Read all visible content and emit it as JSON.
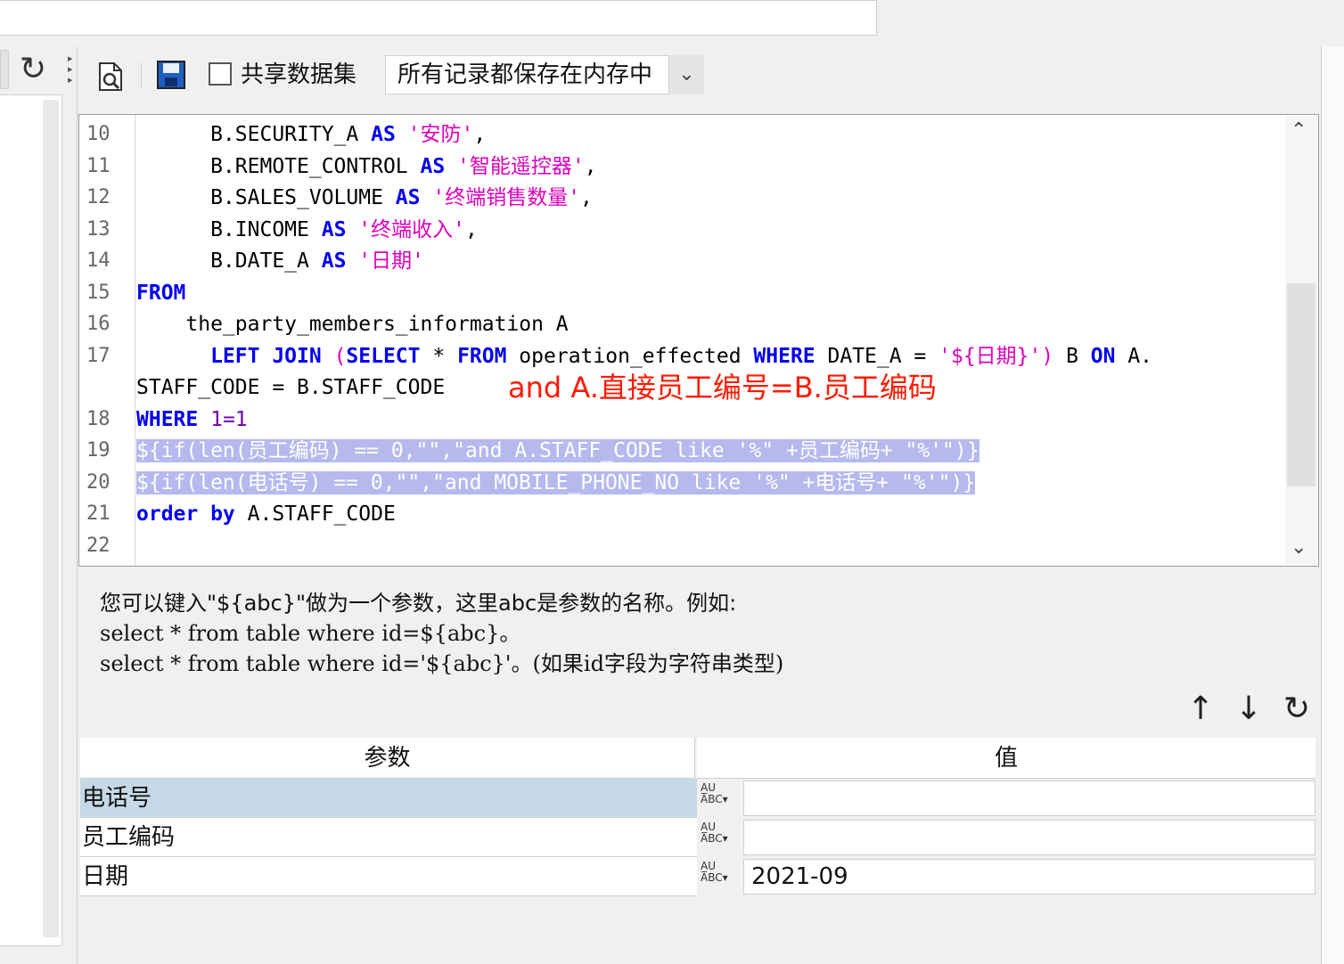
{
  "toolbar": {
    "share_label": "共享数据集",
    "records_select": "所有记录都保存在内存中"
  },
  "editor": {
    "line_numbers": [
      "10",
      "11",
      "12",
      "13",
      "14",
      "15",
      "16",
      "17",
      "18",
      "19",
      "20",
      "21",
      "22"
    ],
    "lines": {
      "l10a": "      B.SECURITY_A ",
      "l10kw": "AS",
      "l10str": " '安防'",
      "l10end": ",",
      "l11a": "      B.REMOTE_CONTROL ",
      "l11kw": "AS",
      "l11str": " '智能遥控器'",
      "l11end": ",",
      "l12a": "      B.SALES_VOLUME ",
      "l12kw": "AS",
      "l12str": " '终端销售数量'",
      "l12end": ",",
      "l13a": "      B.INCOME ",
      "l13kw": "AS",
      "l13str": " '终端收入'",
      "l13end": ",",
      "l14a": "      B.DATE_A ",
      "l14kw": "AS",
      "l14str": " '日期'",
      "l15kw": "FROM",
      "l16": "    the_party_members_information A",
      "l17kw1": "      LEFT JOIN",
      "l17p": " (",
      "l17kw2": "SELECT",
      "l17star": " * ",
      "l17kw3": "FROM",
      "l17mid": " operation_effected ",
      "l17kw4": "WHERE",
      "l17mid2": " DATE_A = ",
      "l17str": "'${日期}')",
      "l17b": " B ",
      "l17kw5": "ON",
      "l17end": " A.",
      "l17wrap": "STAFF_CODE = B.STAFF_CODE",
      "l18kw": "WHERE",
      "l18num": " 1=1",
      "l19": "${if(len(员工编码) == 0,\"\",\"and A.STAFF_CODE like '%\" +员工编码+ \"%'\")}",
      "l20": "${if(len(电话号) == 0,\"\",\"and MOBILE_PHONE_NO like '%\" +电话号+ \"%'\")}",
      "l21kw": "order by",
      "l21": " A.STAFF_CODE"
    },
    "annotation": "and A.直接员工编号=B.员工编码"
  },
  "help": {
    "line1": "您可以键入\"${abc}\"做为一个参数，这里abc是参数的名称。例如:",
    "line2": "select * from table where id=${abc}。",
    "line3": "select * from table where id='${abc}'。(如果id字段为字符串类型)"
  },
  "params": {
    "header_param": "参数",
    "header_value": "值",
    "type_top": "A̲U",
    "type_bottom": "ABC",
    "rows": [
      {
        "name": "电话号",
        "value": ""
      },
      {
        "name": "员工编码",
        "value": ""
      },
      {
        "name": "日期",
        "value": "2021-09"
      }
    ]
  }
}
